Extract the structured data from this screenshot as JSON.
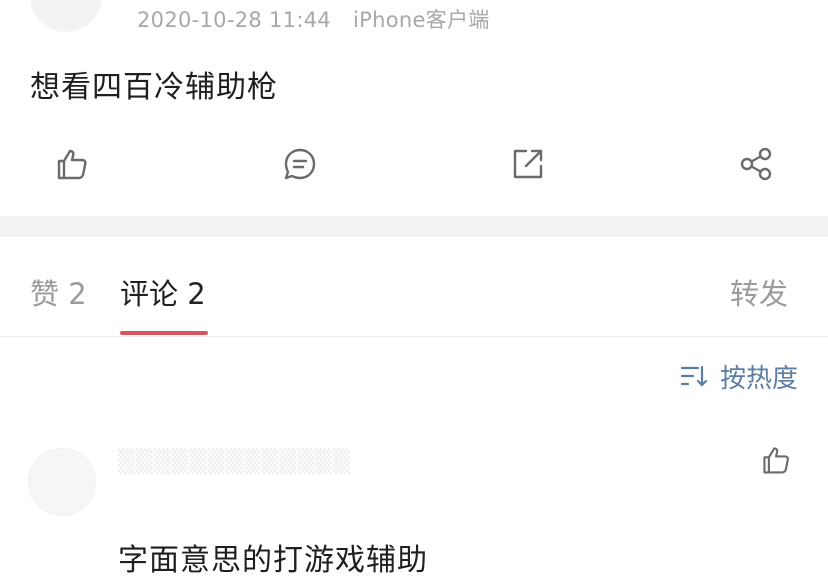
{
  "post": {
    "timestamp": "2020-10-28 11:44",
    "source": "iPhone客户端",
    "text": "想看四百冷辅助枪"
  },
  "actions": {
    "like_icon": "thumbs-up-icon",
    "comment_icon": "comment-bubble-icon",
    "repost_icon": "external-link-icon",
    "share_icon": "share-icon"
  },
  "tabs": {
    "likes": "赞 2",
    "comments": "评论 2",
    "reposts": "转发",
    "active_color": "#d9545f"
  },
  "sort": {
    "label": "按热度",
    "icon": "sort-icon",
    "color": "#5d7ea3"
  },
  "comment": {
    "text": "字面意思的打游戏辅助",
    "like_icon": "thumbs-up-icon"
  }
}
